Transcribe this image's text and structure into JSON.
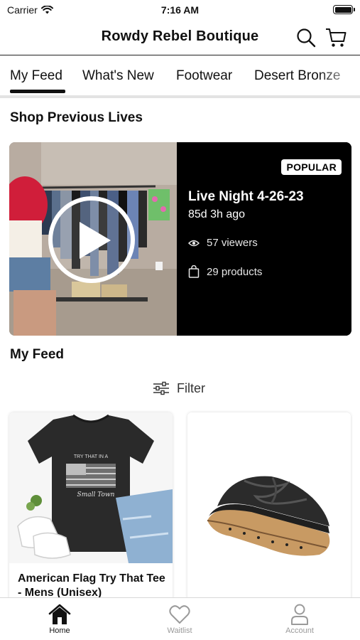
{
  "status_bar": {
    "carrier": "Carrier",
    "time": "7:16 AM"
  },
  "header": {
    "title": "Rowdy Rebel Boutique"
  },
  "tabs": [
    {
      "label": "My Feed",
      "active": true
    },
    {
      "label": "What's New"
    },
    {
      "label": "Footwear"
    },
    {
      "label": "Desert Bronze"
    }
  ],
  "previous_lives": {
    "section_title": "Shop Previous Lives",
    "card": {
      "badge": "POPULAR",
      "title": "Live Night 4-26-23",
      "ago": "85d 3h ago",
      "viewers": "57 viewers",
      "products": "29 products"
    }
  },
  "feed": {
    "section_title": "My Feed",
    "filter_label": "Filter",
    "products": [
      {
        "name": "American Flag Try That Tee - Mens (Unisex)",
        "shirt_print": "TRY THAT IN A",
        "shirt_script": "Small Town"
      },
      {
        "name": ""
      }
    ]
  },
  "bottom_nav": {
    "items": [
      {
        "label": "Home",
        "icon": "home-icon",
        "active": true
      },
      {
        "label": "Waitlist",
        "icon": "heart-icon"
      },
      {
        "label": "Account",
        "icon": "person-icon"
      }
    ]
  },
  "colors": {
    "accent": "#000000",
    "inactive": "#9a9a9a",
    "tab_track": "#e3e3e3"
  }
}
